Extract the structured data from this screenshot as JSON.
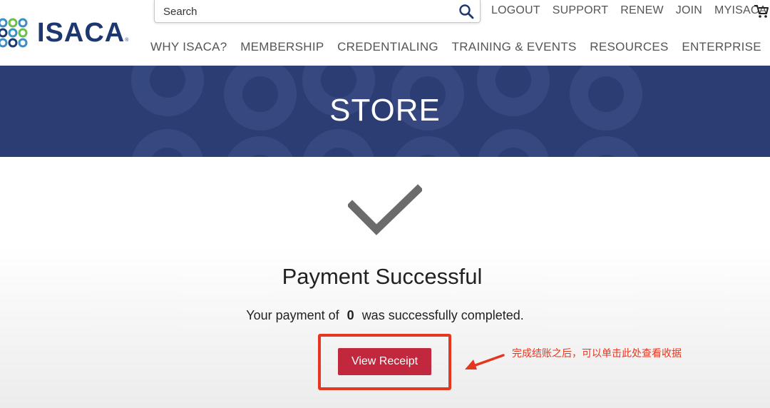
{
  "brand": {
    "name": "ISACA",
    "registered": "®",
    "color": "#1d3770"
  },
  "search": {
    "placeholder": "Search",
    "icon": "search-icon"
  },
  "util_nav": [
    "LOGOUT",
    "SUPPORT",
    "RENEW",
    "JOIN",
    "MYISACA"
  ],
  "cart": {
    "icon": "cart-icon"
  },
  "main_nav": [
    "WHY ISACA?",
    "MEMBERSHIP",
    "CREDENTIALING",
    "TRAINING & EVENTS",
    "RESOURCES",
    "ENTERPRISE"
  ],
  "banner": {
    "title": "STORE",
    "color": "#2c3d73"
  },
  "payment": {
    "icon": "checkmark-icon",
    "title": "Payment Successful",
    "message_prefix": "Your payment of",
    "amount": "0",
    "message_suffix": "was successfully completed.",
    "button_label": "View Receipt",
    "button_color": "#c2283d"
  },
  "annotation": {
    "text": "完成结账之后，可以单击此处查看收据",
    "color": "#e5361f"
  }
}
